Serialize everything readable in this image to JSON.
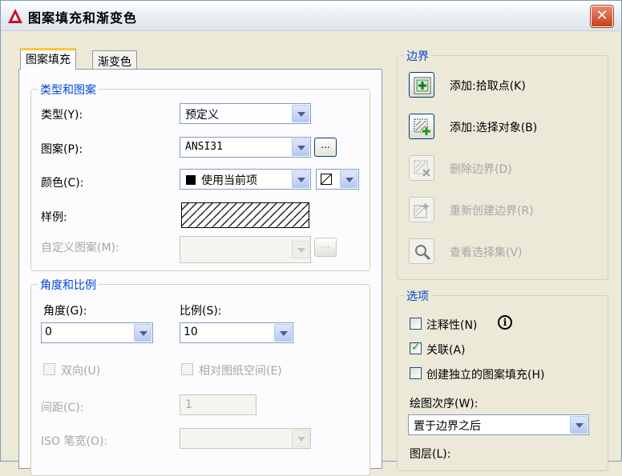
{
  "window": {
    "title": "图案填充和渐变色",
    "close": "✕"
  },
  "tabs": [
    {
      "label": "图案填充"
    },
    {
      "label": "渐变色"
    }
  ],
  "type_pattern": {
    "legend": "类型和图案",
    "type_label": "类型(Y):",
    "type_value": "预定义",
    "pattern_label": "图案(P):",
    "pattern_value": "ANSI31",
    "pattern_browse": "...",
    "color_label": "颜色(C):",
    "color_value": "使用当前项",
    "swatch_label": "样例:",
    "custom_label": "自定义图案(M):",
    "custom_browse": "..."
  },
  "angle_scale": {
    "legend": "角度和比例",
    "angle_label": "角度(G):",
    "angle_value": "0",
    "scale_label": "比例(S):",
    "scale_value": "10",
    "double_label": "双向(U)",
    "relative_label": "相对图纸空间(E)",
    "spacing_label": "间距(C):",
    "spacing_value": "1",
    "iso_label": "ISO 笔宽(O):"
  },
  "boundaries": {
    "legend": "边界",
    "add_pick": "添加:拾取点(K)",
    "add_select": "添加:选择对象(B)",
    "remove": "删除边界(D)",
    "recreate": "重新创建边界(R)",
    "view_selection": "查看选择集(V)"
  },
  "options": {
    "legend": "选项",
    "annotative": "注释性(N)",
    "annotative_info": "i",
    "associative": "关联(A)",
    "associative_checked": true,
    "independent": "创建独立的图案填充(H)",
    "draw_order_label": "绘图次序(W):",
    "draw_order_value": "置于边界之后",
    "layer_label": "图层(L):"
  },
  "colors": {
    "accent": "#0046d5",
    "tab_highlight": "#ffc83c",
    "dialog_bg": "#ece9d8"
  }
}
